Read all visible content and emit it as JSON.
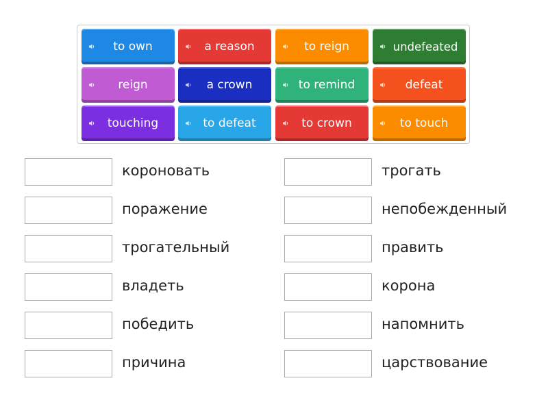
{
  "tiles": [
    {
      "label": "to own",
      "color": "#1e88e5"
    },
    {
      "label": "a reason",
      "color": "#e53935"
    },
    {
      "label": "to reign",
      "color": "#fb8c00"
    },
    {
      "label": "undefeated",
      "color": "#2e7d32"
    },
    {
      "label": "reign",
      "color": "#c05bd4"
    },
    {
      "label": "a crown",
      "color": "#1a2fc2"
    },
    {
      "label": "to remind",
      "color": "#2fb37a"
    },
    {
      "label": "defeat",
      "color": "#f4511e"
    },
    {
      "label": "touching",
      "color": "#7b2fe0"
    },
    {
      "label": "to defeat",
      "color": "#29a6e8"
    },
    {
      "label": "to crown",
      "color": "#e53935"
    },
    {
      "label": "to touch",
      "color": "#fb8c00"
    }
  ],
  "targets_left": [
    "короновать",
    "поражение",
    "трогательный",
    "владеть",
    "победить",
    "причина"
  ],
  "targets_right": [
    "трогать",
    "непобежденный",
    "править",
    "корона",
    "напомнить",
    "царствование"
  ],
  "icons": {
    "tile_icon": "speaker-icon"
  }
}
